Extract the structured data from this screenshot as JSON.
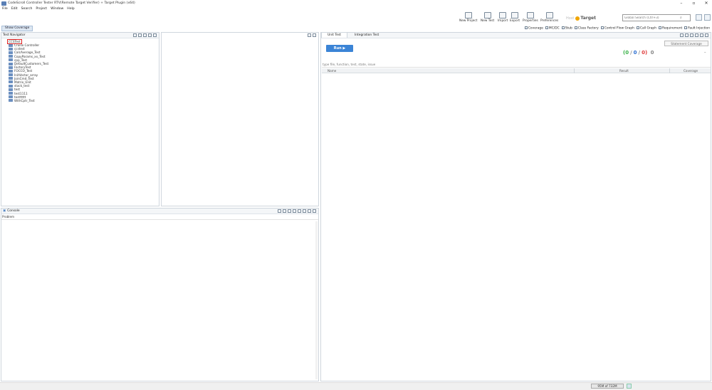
{
  "window": {
    "title": "CodeScroll Controller Tester RTV(Remote Target Verifier) + Target Plugin (x64)",
    "controls": [
      "–",
      "▫",
      "✕"
    ]
  },
  "menu": [
    "File",
    "Edit",
    "Search",
    "Project",
    "Window",
    "Help"
  ],
  "toolbar": {
    "buttons": [
      {
        "label": "New Project",
        "icon": "new-project-icon"
      },
      {
        "label": "New Test",
        "icon": "new-test-icon"
      },
      {
        "label": "Import",
        "icon": "import-icon"
      },
      {
        "label": "Export",
        "icon": "export-icon"
      },
      {
        "label": "Properties",
        "icon": "properties-icon"
      },
      {
        "label": "Preferences",
        "icon": "preferences-icon"
      }
    ],
    "host_label": "Host",
    "target_label": "Target",
    "search_placeholder": "Global Search (Ctrl+3)"
  },
  "secondbar": {
    "show_coverage": "Show Coverage",
    "tools": [
      "Coverage",
      "MC/DC",
      "Stub",
      "Class Factory",
      "Control Flow Graph",
      "Call Graph",
      "Requirement",
      "Fault Injection"
    ]
  },
  "navigator": {
    "title": "Test Navigator",
    "root": "CCSTest",
    "items": [
      "Cruise Controller",
      "ccstest",
      "CalcAverage_Test",
      "CopyParams_xx_Test",
      "cpp_Test",
      "DefaultCustomers_Test",
      "FactoryTest",
      "FOCCO_Test",
      "InitVector_array",
      "JoinCmd_Test",
      "Matrix_Unit",
      "stack_test",
      "test",
      "test1111",
      "testttttt",
      "WithCptr_Test"
    ]
  },
  "console": {
    "title": "Console",
    "subtitle": "Problem"
  },
  "unit_test": {
    "tabs": [
      "Unit Test",
      "Integration Test"
    ],
    "run_label": "Run ▶",
    "statement_coverage": "Statement Coverage",
    "counts": {
      "passed": "0",
      "sep1": "/",
      "total": "0",
      "sep2": "/",
      "failed": "0",
      "other": "0"
    },
    "filter_placeholder": "type file, function, test, state, issue",
    "columns": [
      "Name",
      "Result",
      "Coverage"
    ]
  },
  "status": {
    "heap": "95M of 732M"
  },
  "colors": {
    "run": "#3b84d6",
    "pass": "#3bb34a",
    "total": "#2c6fd1",
    "fail": "#e04040",
    "highlight": "#e02020"
  }
}
